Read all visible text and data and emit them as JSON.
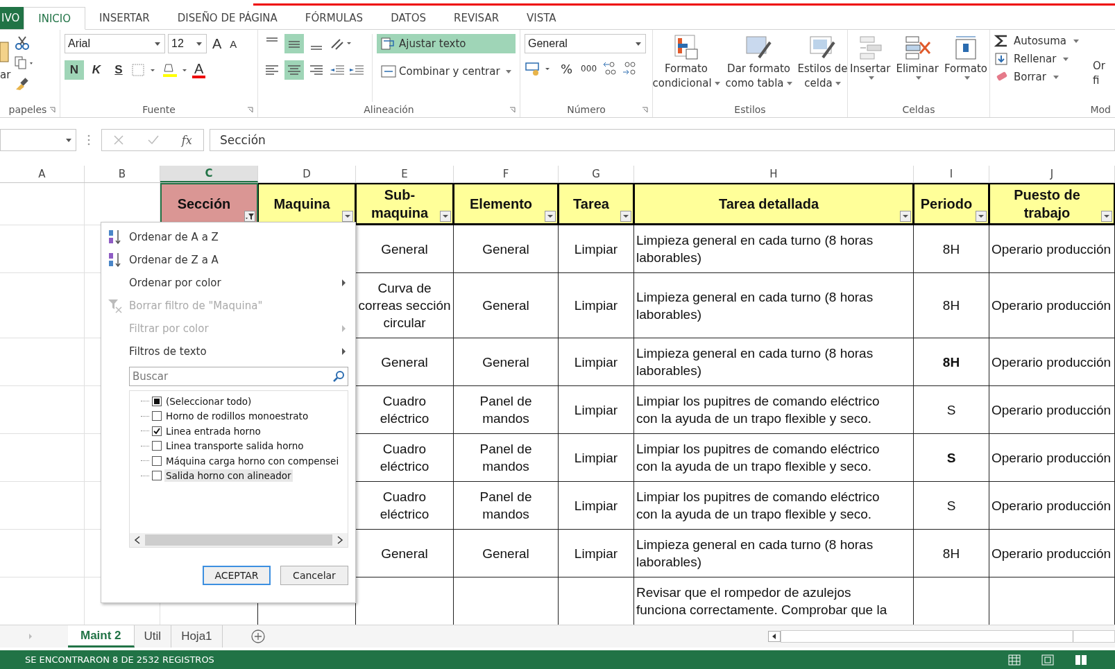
{
  "file_tab": "IVO",
  "ribbon_tabs": [
    {
      "label": "INICIO",
      "selected": true,
      "kind": "tab"
    },
    {
      "label": "INSERTAR",
      "selected": false,
      "kind": "tab"
    },
    {
      "label": "DISEÑO DE PÁGINA",
      "selected": false,
      "kind": "tab"
    },
    {
      "label": "FÓRMULAS",
      "selected": false,
      "kind": "tab"
    },
    {
      "label": "DATOS",
      "selected": false,
      "kind": "tab"
    },
    {
      "label": "REVISAR",
      "selected": false,
      "kind": "tab"
    },
    {
      "label": "VISTA",
      "selected": false,
      "kind": "tab"
    }
  ],
  "clipboard": {
    "paste_label": "ar",
    "label": "papeles"
  },
  "font": {
    "family": "Arial",
    "size": "12",
    "grow": "A",
    "shrink": "A",
    "color_letter": "A",
    "label": "Fuente",
    "styles": [
      {
        "label": "N",
        "kind": "bold",
        "on": true
      },
      {
        "label": "K",
        "kind": "italic",
        "on": false
      },
      {
        "label": "S",
        "kind": "underline",
        "on": false
      }
    ]
  },
  "alignment": {
    "label": "Alineación",
    "wrap": {
      "label": "Ajustar texto",
      "on": true
    },
    "merge": "Combinar y centrar",
    "vertical": [
      {
        "kind": "top",
        "selected": false
      },
      {
        "kind": "middle",
        "selected": true
      },
      {
        "kind": "bottom",
        "selected": false
      }
    ],
    "horizontal": [
      {
        "kind": "left",
        "selected": false
      },
      {
        "kind": "center",
        "selected": true
      },
      {
        "kind": "right",
        "selected": false
      }
    ]
  },
  "number": {
    "format": "General",
    "percent": "%",
    "thousands": "000",
    "label": "Número"
  },
  "styles": {
    "label": "Estilos",
    "buttons": [
      {
        "line1": "Formato",
        "line2": "condicional",
        "kind": "conditional"
      },
      {
        "line1": "Dar formato",
        "line2": "como tabla",
        "kind": "table"
      },
      {
        "line1": "Estilos de",
        "line2": "celda",
        "kind": "cell"
      }
    ]
  },
  "cells": {
    "label": "Celdas",
    "buttons": [
      {
        "label": "Insertar",
        "kind": "insert"
      },
      {
        "label": "Eliminar",
        "kind": "delete"
      },
      {
        "label": "Formato",
        "kind": "format"
      }
    ]
  },
  "editing": {
    "label": "Mod",
    "items": [
      {
        "label": "Autosuma",
        "kind": "sum"
      },
      {
        "label": "Rellenar",
        "kind": "fill"
      },
      {
        "label": "Borrar",
        "kind": "clear"
      }
    ],
    "sort_line1": "Or",
    "sort_line2": "fi"
  },
  "formula_bar": {
    "fx": "fx",
    "value": "Sección"
  },
  "column_headers": [
    {
      "label": "A",
      "selected": false
    },
    {
      "label": "B",
      "selected": false
    },
    {
      "label": "C",
      "selected": true
    },
    {
      "label": "D",
      "selected": false
    },
    {
      "label": "E",
      "selected": false
    },
    {
      "label": "F",
      "selected": false
    },
    {
      "label": "G",
      "selected": false
    },
    {
      "label": "H",
      "selected": false
    },
    {
      "label": "I",
      "selected": false
    },
    {
      "label": "J",
      "selected": false
    }
  ],
  "table_headers": [
    {
      "label": "Sección",
      "color": "#da9694",
      "filtered": true
    },
    {
      "label": "Maquina",
      "color": "#ffff99",
      "filtered": false
    },
    {
      "label": "Sub-maquina",
      "color": "#ffff99",
      "filtered": false
    },
    {
      "label": "Elemento",
      "color": "#ffff99",
      "filtered": false
    },
    {
      "label": "Tarea",
      "color": "#ffff99",
      "filtered": false
    },
    {
      "label": "Tarea detallada",
      "color": "#ffff99",
      "filtered": false
    },
    {
      "label": "Periodo",
      "color": "#ffff99",
      "filtered": false
    },
    {
      "label": "Puesto de trabajo",
      "color": "#ffff99",
      "filtered": false
    }
  ],
  "rows": [
    {
      "sub": "General",
      "elemento": "General",
      "tarea": "Limpiar",
      "detalle": "Limpieza general en cada turno (8 horas laborables)",
      "periodo": "8H",
      "periodo_bold": false,
      "puesto": "Operario producción"
    },
    {
      "sub": "Curva de correas sección circular",
      "elemento": "General",
      "tarea": "Limpiar",
      "detalle": "Limpieza general en cada turno (8 horas laborables)",
      "periodo": "8H",
      "periodo_bold": false,
      "puesto": "Operario producción"
    },
    {
      "sub": "General",
      "elemento": "General",
      "tarea": "Limpiar",
      "detalle": "Limpieza general en cada turno (8 horas laborables)",
      "periodo": "8H",
      "periodo_bold": true,
      "puesto": "Operario producción"
    },
    {
      "sub": "Cuadro eléctrico",
      "elemento": "Panel de mandos",
      "tarea": "Limpiar",
      "detalle": "Limpiar los pupitres de comando eléctrico con la ayuda de un trapo flexible y seco.",
      "periodo": "S",
      "periodo_bold": false,
      "puesto": "Operario producción"
    },
    {
      "sub": "Cuadro eléctrico",
      "elemento": "Panel de mandos",
      "tarea": "Limpiar",
      "detalle": "Limpiar los pupitres de comando eléctrico con la ayuda de un trapo flexible y seco.",
      "periodo": "S",
      "periodo_bold": true,
      "puesto": "Operario producción"
    },
    {
      "sub": "Cuadro eléctrico",
      "elemento": "Panel de mandos",
      "tarea": "Limpiar",
      "detalle": "Limpiar los pupitres de comando eléctrico con la ayuda de un trapo flexible y seco.",
      "periodo": "S",
      "periodo_bold": false,
      "puesto": "Operario producción"
    },
    {
      "sub": "General",
      "elemento": "General",
      "tarea": "Limpiar",
      "detalle": "Limpieza general en cada turno (8 horas laborables)",
      "periodo": "8H",
      "periodo_bold": false,
      "puesto": "Operario producción"
    },
    {
      "detalle": "Revisar que el rompedor de azulejos funciona correctamente. Comprobar que la"
    }
  ],
  "filter_menu": {
    "items": [
      {
        "label": "Ordenar de A a Z",
        "kind": "sort-az",
        "disabled": false,
        "submenu": false
      },
      {
        "label": "Ordenar de Z a A",
        "kind": "sort-za",
        "disabled": false,
        "submenu": false
      },
      {
        "label": "Ordenar por color",
        "kind": "plain",
        "disabled": false,
        "submenu": true
      },
      {
        "label": "Borrar filtro de \"Maquina\"",
        "kind": "clear",
        "disabled": true,
        "submenu": false
      },
      {
        "label": "Filtrar por color",
        "kind": "plain",
        "disabled": true,
        "submenu": true
      },
      {
        "label": "Filtros de texto",
        "kind": "plain",
        "disabled": false,
        "submenu": true
      }
    ],
    "search": {
      "placeholder": "Buscar"
    },
    "values": [
      {
        "label": "(Seleccionar todo)",
        "checked": false,
        "mixed": true,
        "selected": false
      },
      {
        "label": "Horno de rodillos monoestrato",
        "checked": false,
        "mixed": false,
        "selected": false
      },
      {
        "label": "Linea entrada horno",
        "checked": true,
        "mixed": false,
        "selected": false
      },
      {
        "label": "Linea transporte salida horno",
        "checked": false,
        "mixed": false,
        "selected": false
      },
      {
        "label": "Máquina carga horno con compensei",
        "checked": false,
        "mixed": false,
        "selected": false
      },
      {
        "label": "Salida horno con alineador",
        "checked": false,
        "mixed": false,
        "selected": true
      }
    ],
    "buttons": [
      {
        "label": "ACEPTAR",
        "kind": "default"
      },
      {
        "label": "Cancelar",
        "kind": "normal"
      }
    ]
  },
  "sheet_tabs": [
    {
      "label": "Maint 2",
      "selected": true
    },
    {
      "label": "Util",
      "selected": false
    },
    {
      "label": "Hoja1",
      "selected": false
    }
  ],
  "status_bar": {
    "message": "SE ENCONTRARON 8 DE 2532 REGISTROS"
  }
}
